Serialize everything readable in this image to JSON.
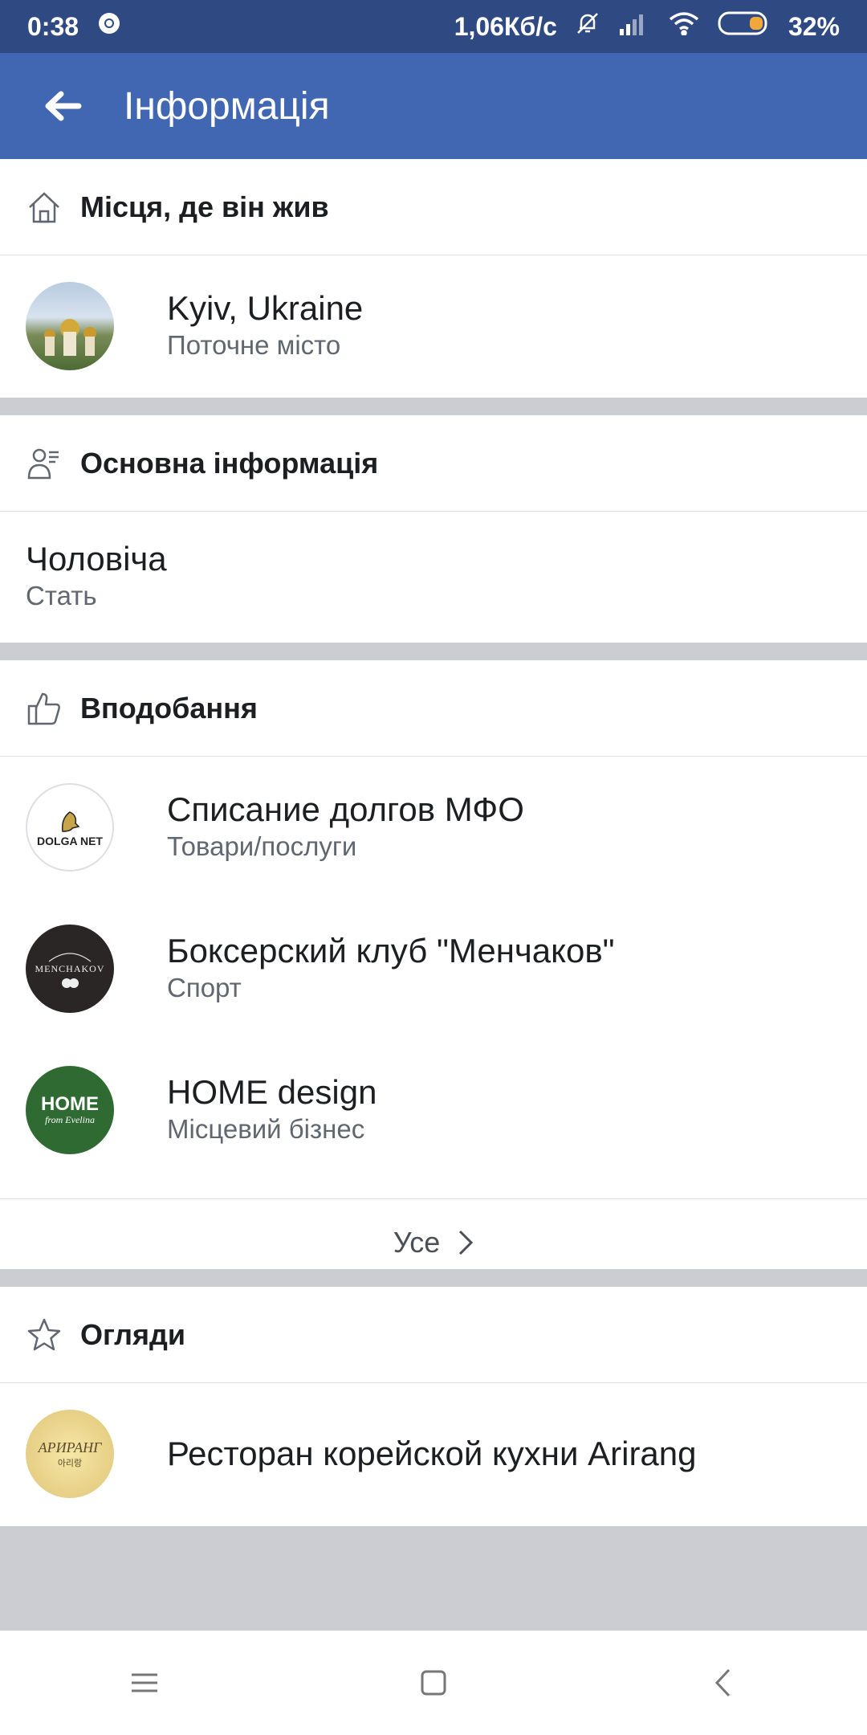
{
  "status": {
    "time": "0:38",
    "speed": "1,06Кб/с",
    "battery": "32%"
  },
  "header": {
    "title": "Інформація"
  },
  "places": {
    "title": "Місця, де він жив",
    "items": [
      {
        "name": "Kyiv, Ukraine",
        "sub": "Поточне місто"
      }
    ]
  },
  "basic": {
    "title": "Основна інформація",
    "gender_value": "Чоловіча",
    "gender_label": "Стать"
  },
  "likes": {
    "title": "Вподобання",
    "items": [
      {
        "name": "Списание долгов МФО",
        "sub": "Товари/послуги",
        "logo_text": "DOLGA NET"
      },
      {
        "name": "Боксерский клуб \"Менчаков\"",
        "sub": "Спорт",
        "logo_text": "MENCHAKOV"
      },
      {
        "name": "HOME design",
        "sub": "Місцевий бізнес",
        "logo_text": "HOME",
        "logo_sub": "from Evelina"
      }
    ],
    "see_all": "Усе"
  },
  "reviews": {
    "title": "Огляди",
    "items": [
      {
        "name": "Ресторан корейской кухни Arirang",
        "logo_text": "АРИРАНГ",
        "logo_sub": "아리랑"
      }
    ]
  },
  "colors": {
    "appbar": "#4267b2",
    "statusbar": "#2f4a82",
    "divider": "#cbcdd2"
  }
}
